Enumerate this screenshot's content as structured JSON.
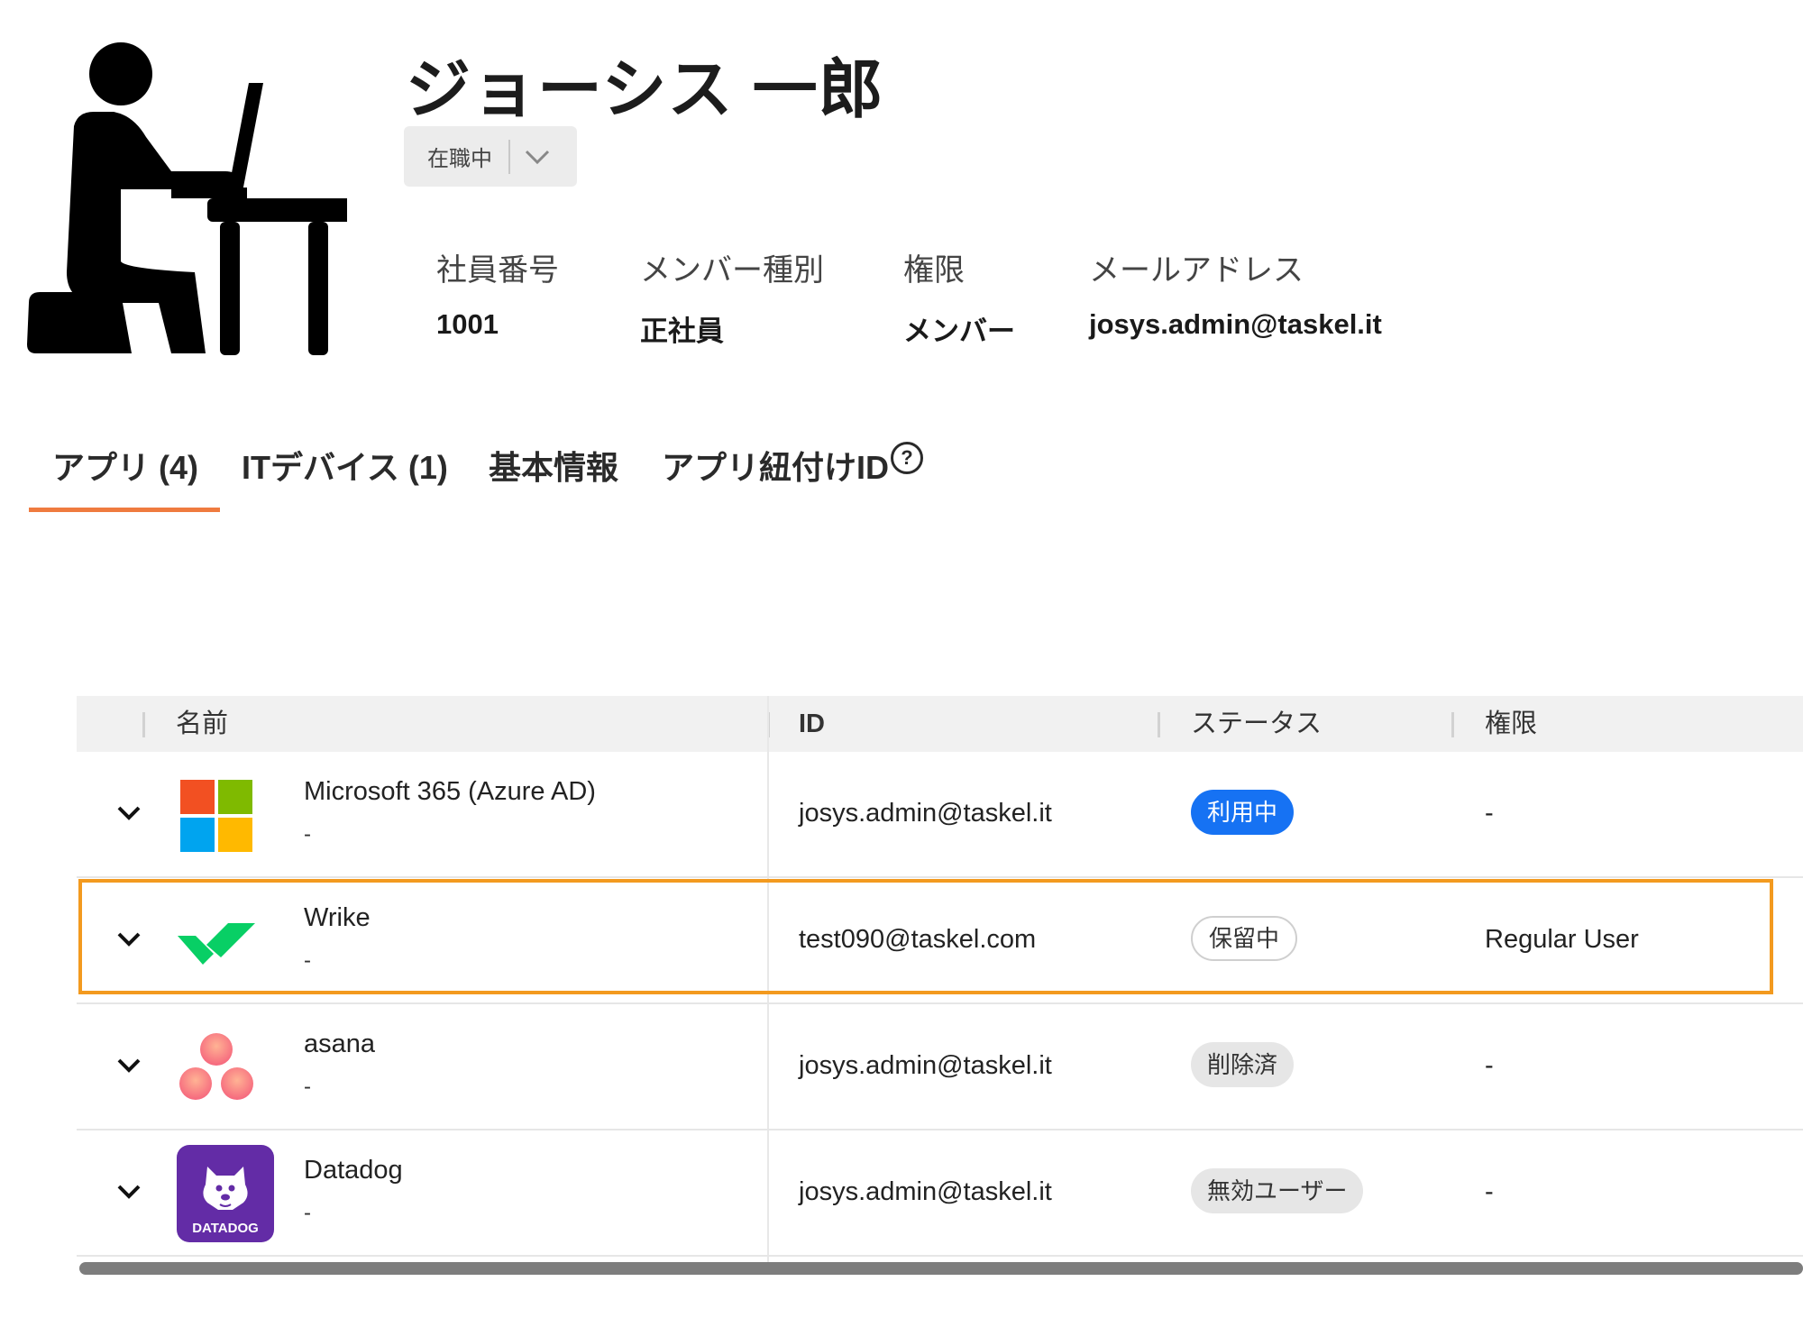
{
  "user": {
    "name": "ジョーシス 一郎",
    "employment_status": "在職中"
  },
  "info": [
    {
      "label": "社員番号",
      "value": "1001"
    },
    {
      "label": "メンバー種別",
      "value": "正社員"
    },
    {
      "label": "権限",
      "value": "メンバー"
    },
    {
      "label": "メールアドレス",
      "value": "josys.admin@taskel.it"
    }
  ],
  "tabs": [
    {
      "label": "アプリ (4)",
      "active": true
    },
    {
      "label": "ITデバイス (1)",
      "active": false
    },
    {
      "label": "基本情報",
      "active": false
    },
    {
      "label": "アプリ紐付けID",
      "active": false
    }
  ],
  "help_glyph": "?",
  "table": {
    "columns": [
      "名前",
      "ID",
      "ステータス",
      "権限"
    ],
    "rows": [
      {
        "name": "Microsoft 365 (Azure AD)",
        "sub": "-",
        "id": "josys.admin@taskel.it",
        "status": "利用中",
        "status_type": "active",
        "role": "-",
        "logo": "microsoft-logo"
      },
      {
        "name": "Wrike",
        "sub": "-",
        "id": "test090@taskel.com",
        "status": "保留中",
        "status_type": "pending",
        "role": "Regular User",
        "logo": "wrike-logo"
      },
      {
        "name": "asana",
        "sub": "-",
        "id": "josys.admin@taskel.it",
        "status": "削除済",
        "status_type": "deleted",
        "role": "-",
        "logo": "asana-logo"
      },
      {
        "name": "Datadog",
        "sub": "-",
        "id": "josys.admin@taskel.it",
        "status": "無効ユーザー",
        "status_type": "disabled",
        "role": "-",
        "logo": "datadog-logo",
        "logo_text": "DATADOG"
      }
    ]
  },
  "colors": {
    "accent": "#ef7b3f",
    "highlight": "#f39a1f",
    "status_active": "#1672f3",
    "datadog": "#632ca6",
    "wrike": "#08cf65"
  }
}
